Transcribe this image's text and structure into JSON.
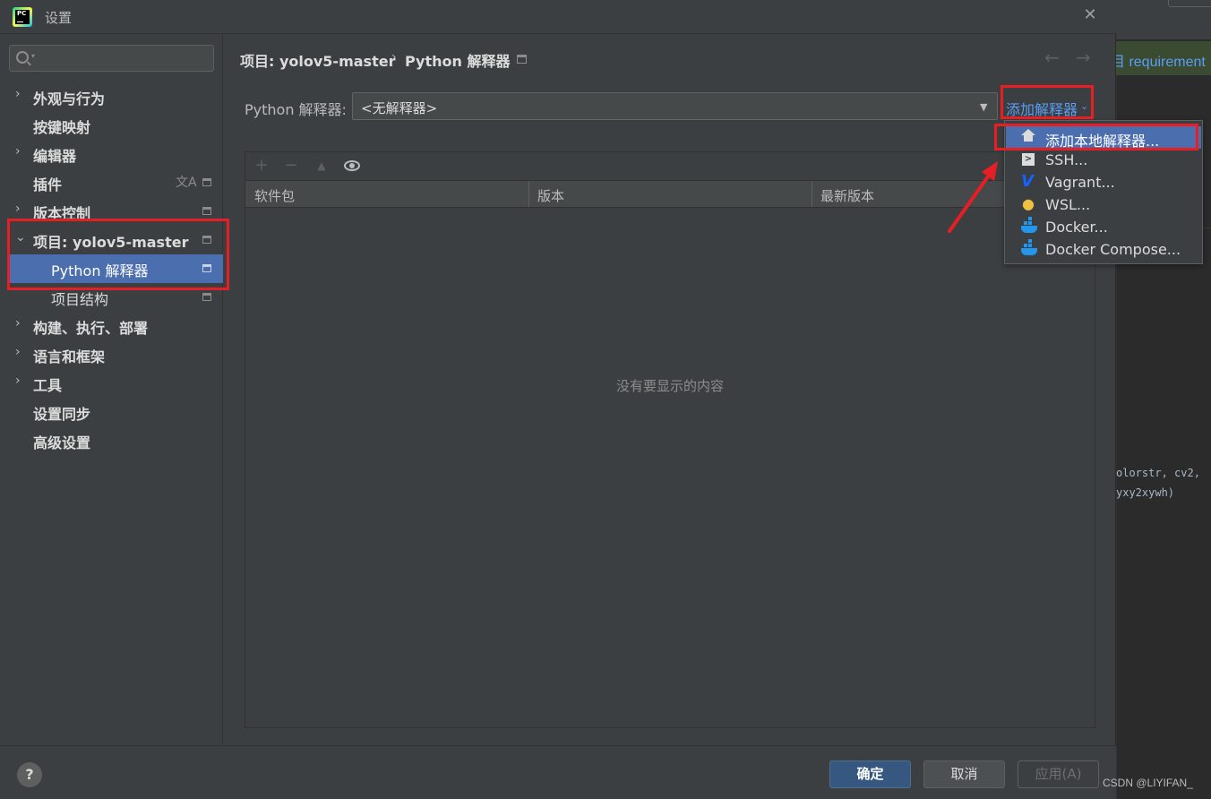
{
  "window": {
    "title": "设置",
    "close_symbol": "✕"
  },
  "background": {
    "banner_text": "目 requirement",
    "code_lines": [
      "olorstr, cv2,",
      "yxy2xywh)"
    ]
  },
  "sidebar": {
    "search_placeholder": "",
    "items": [
      {
        "label": "外观与行为",
        "chevron": "›",
        "bold": true
      },
      {
        "label": "按键映射",
        "bold": true
      },
      {
        "label": "编辑器",
        "chevron": "›",
        "bold": true
      },
      {
        "label": "插件",
        "bold": true,
        "translate_icon": "文A"
      },
      {
        "label": "版本控制",
        "chevron": "›",
        "bold": true
      },
      {
        "label": "项目: yolov5-master",
        "chevron": "⌄",
        "bold": true
      },
      {
        "label": "Python 解释器",
        "selected": true
      },
      {
        "label": "项目结构"
      },
      {
        "label": "构建、执行、部署",
        "chevron": "›",
        "bold": true
      },
      {
        "label": "语言和框架",
        "chevron": "›",
        "bold": true
      },
      {
        "label": "工具",
        "chevron": "›",
        "bold": true
      },
      {
        "label": "设置同步",
        "bold": true
      },
      {
        "label": "高级设置",
        "bold": true
      }
    ]
  },
  "breadcrumb": {
    "part1": "项目: yolov5-master",
    "separator": "›",
    "part2": "Python 解释器"
  },
  "nav": {
    "back": "←",
    "forward": "→"
  },
  "interpreter": {
    "label": "Python 解释器:",
    "value": "<无解释器>",
    "add_label": "添加解释器",
    "add_caret": "⌄"
  },
  "packages": {
    "toolbar": {
      "add": "+",
      "remove": "−",
      "up": "▲"
    },
    "columns": [
      "软件包",
      "版本",
      "最新版本"
    ],
    "empty_text": "没有要显示的内容"
  },
  "add_menu": {
    "items": [
      {
        "label": "添加本地解释器...",
        "icon": "home-icon",
        "active": true
      },
      {
        "label": "SSH...",
        "icon": "ssh-icon"
      },
      {
        "label": "Vagrant...",
        "icon": "vagrant-icon"
      },
      {
        "label": "WSL...",
        "icon": "linux-icon"
      },
      {
        "label": "Docker...",
        "icon": "docker-icon"
      },
      {
        "label": "Docker Compose...",
        "icon": "docker-icon"
      }
    ]
  },
  "buttons": {
    "help": "?",
    "ok": "确定",
    "cancel": "取消",
    "apply": "应用(A)"
  },
  "watermark": "CSDN @LIYIFAN_",
  "colors": {
    "accent": "#4b6eaf",
    "link": "#589df6",
    "highlight_box": "#e81e25"
  }
}
